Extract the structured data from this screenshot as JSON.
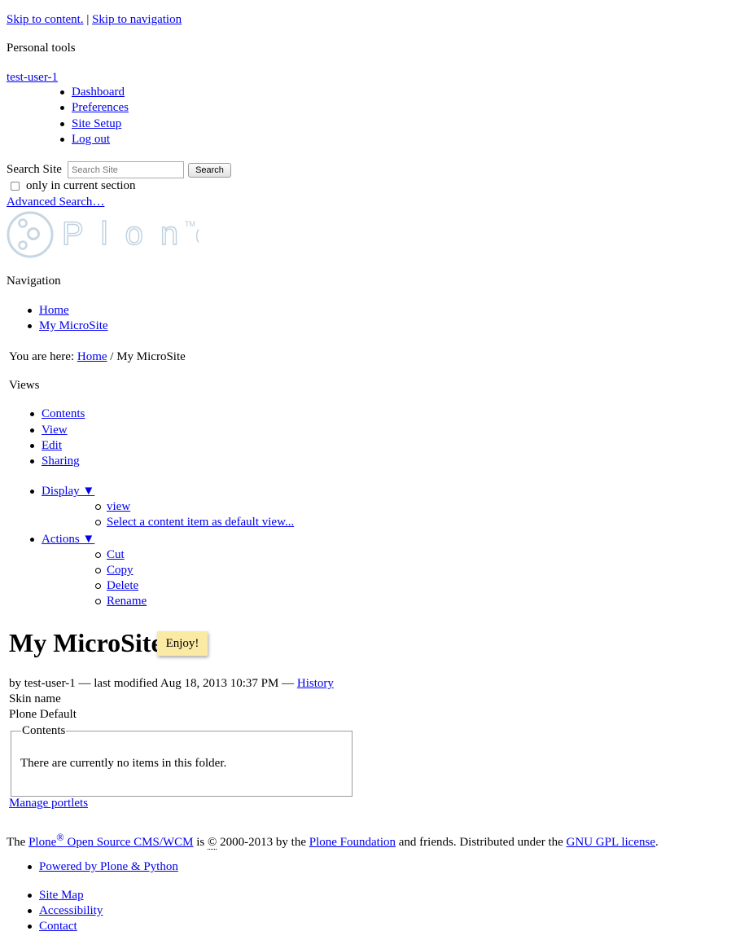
{
  "skip_links": {
    "content": "Skip to content.",
    "separator": "|",
    "navigation": "Skip to navigation"
  },
  "personal_tools": {
    "heading": "Personal tools",
    "user": "test-user-1",
    "items": [
      "Dashboard",
      "Preferences",
      "Site Setup",
      "Log out"
    ]
  },
  "search": {
    "label": "Search Site",
    "placeholder": "Search Site",
    "button": "Search",
    "only_current_section": "only in current section",
    "advanced": "Advanced Search…"
  },
  "logo": {
    "text": "Plone",
    "tm": "TM"
  },
  "navigation": {
    "heading": "Navigation",
    "items": [
      "Home",
      "My MicroSite"
    ]
  },
  "breadcrumb": {
    "prefix": "You are here:",
    "home": "Home",
    "separator": "/",
    "current": "My MicroSite"
  },
  "views": {
    "heading": "Views",
    "items": [
      "Contents",
      "View",
      "Edit",
      "Sharing"
    ],
    "display": {
      "label": "Display ▼",
      "items": [
        "view",
        "Select a content item as default view..."
      ]
    },
    "actions": {
      "label": "Actions ▼",
      "items": [
        "Cut",
        "Copy",
        "Delete",
        "Rename"
      ]
    }
  },
  "page": {
    "title": "My MicroSite",
    "tooltip": "Enjoy!",
    "byline_author": "by test-user-1",
    "byline_dash1": "—",
    "byline_modified": "last modified Aug 18, 2013 10:37 PM",
    "byline_dash2": "—",
    "history": "History",
    "skin_label": "Skin name",
    "skin_value": "Plone Default",
    "contents_legend": "Contents",
    "empty_message": "There are currently no items in this folder.",
    "manage_portlets": "Manage portlets"
  },
  "footer": {
    "the": "The",
    "plone": "Plone",
    "reg": "®",
    "open_source": "Open Source CMS/WCM",
    "is": "is",
    "copyright_symbol": "©",
    "years": "2000-2013 by the",
    "foundation": "Plone Foundation",
    "and_friends": "and friends. Distributed under the",
    "license": "GNU GPL license",
    "period": ".",
    "powered": "Powered by Plone & Python",
    "site_actions": [
      "Site Map",
      "Accessibility",
      "Contact"
    ]
  }
}
